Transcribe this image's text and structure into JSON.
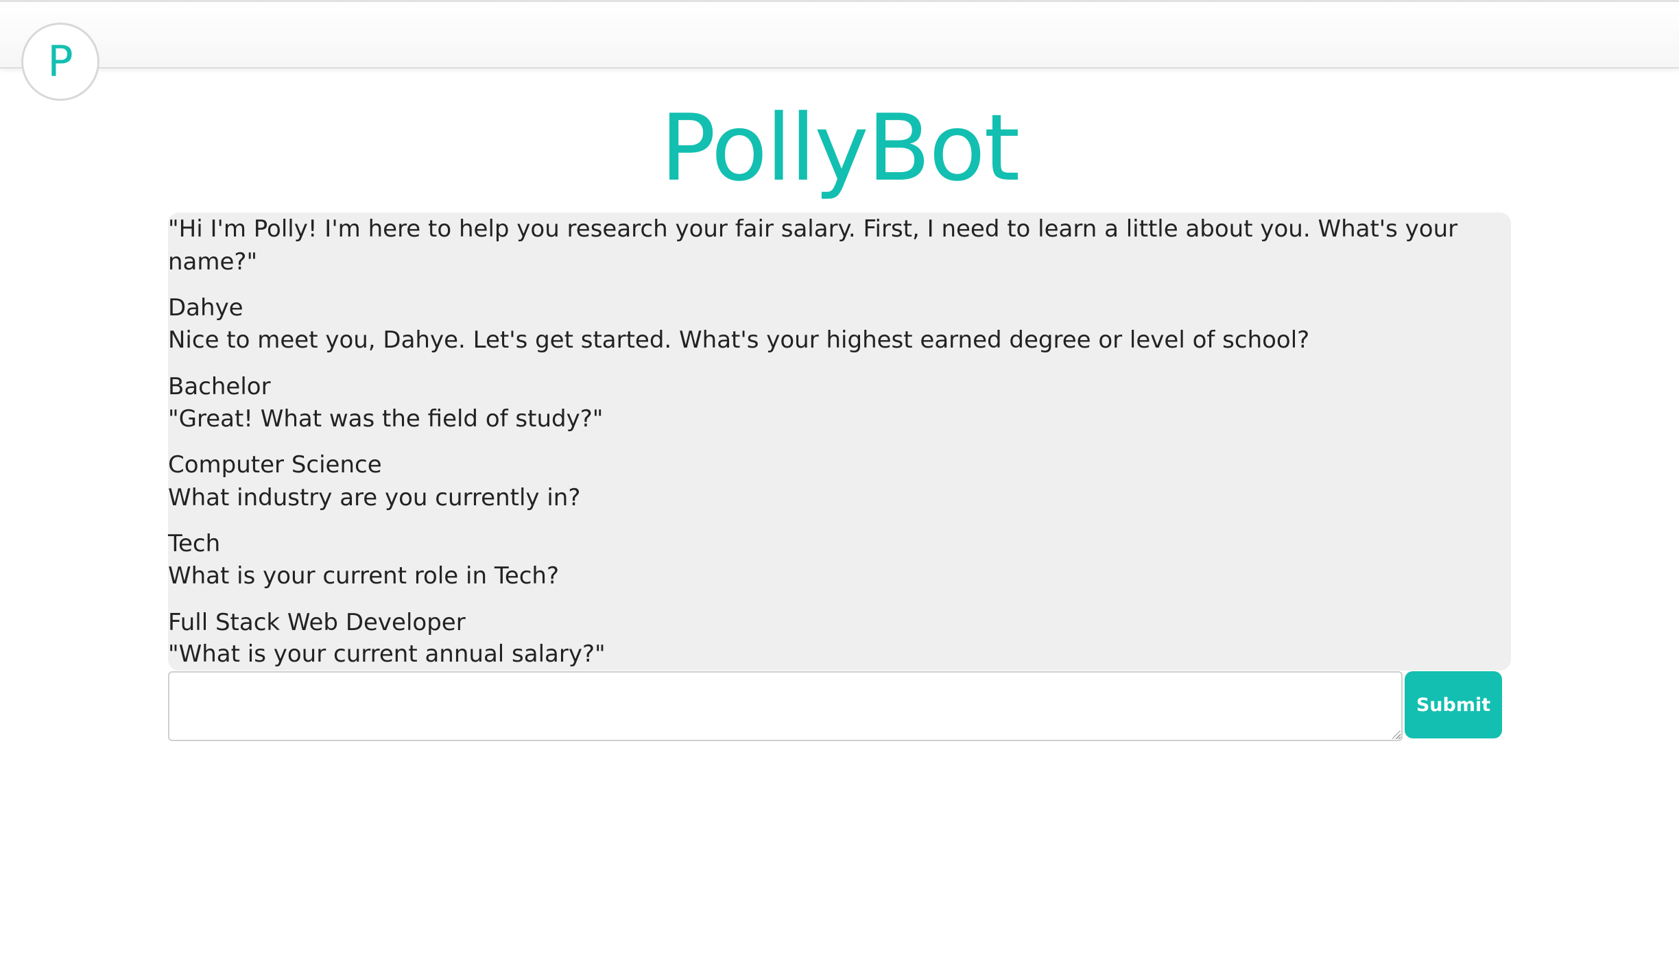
{
  "header": {
    "logo_letter": "P"
  },
  "page": {
    "title": "PollyBot"
  },
  "chat": {
    "messages": [
      {
        "sender": "bot",
        "text": "\"Hi I'm Polly! I'm here to help you research your fair salary. First, I need to learn a little about you. What's your name?\""
      },
      {
        "sender": "user",
        "text": "Dahye"
      },
      {
        "sender": "bot",
        "text": "Nice to meet you, Dahye. Let's get started. What's your highest earned degree or level of school?"
      },
      {
        "sender": "user",
        "text": "Bachelor"
      },
      {
        "sender": "bot",
        "text": "\"Great! What was the field of study?\""
      },
      {
        "sender": "user",
        "text": "Computer Science"
      },
      {
        "sender": "bot",
        "text": "What industry are you currently in?"
      },
      {
        "sender": "user",
        "text": "Tech"
      },
      {
        "sender": "bot",
        "text": "What is your current role in Tech?"
      },
      {
        "sender": "user",
        "text": "Full Stack Web Developer"
      },
      {
        "sender": "bot",
        "text": "\"What is your current annual salary?\""
      }
    ]
  },
  "composer": {
    "input_value": "",
    "submit_label": "Submit"
  },
  "colors": {
    "accent": "#13bfb0",
    "chat_background": "#efefef",
    "text": "#222222"
  }
}
